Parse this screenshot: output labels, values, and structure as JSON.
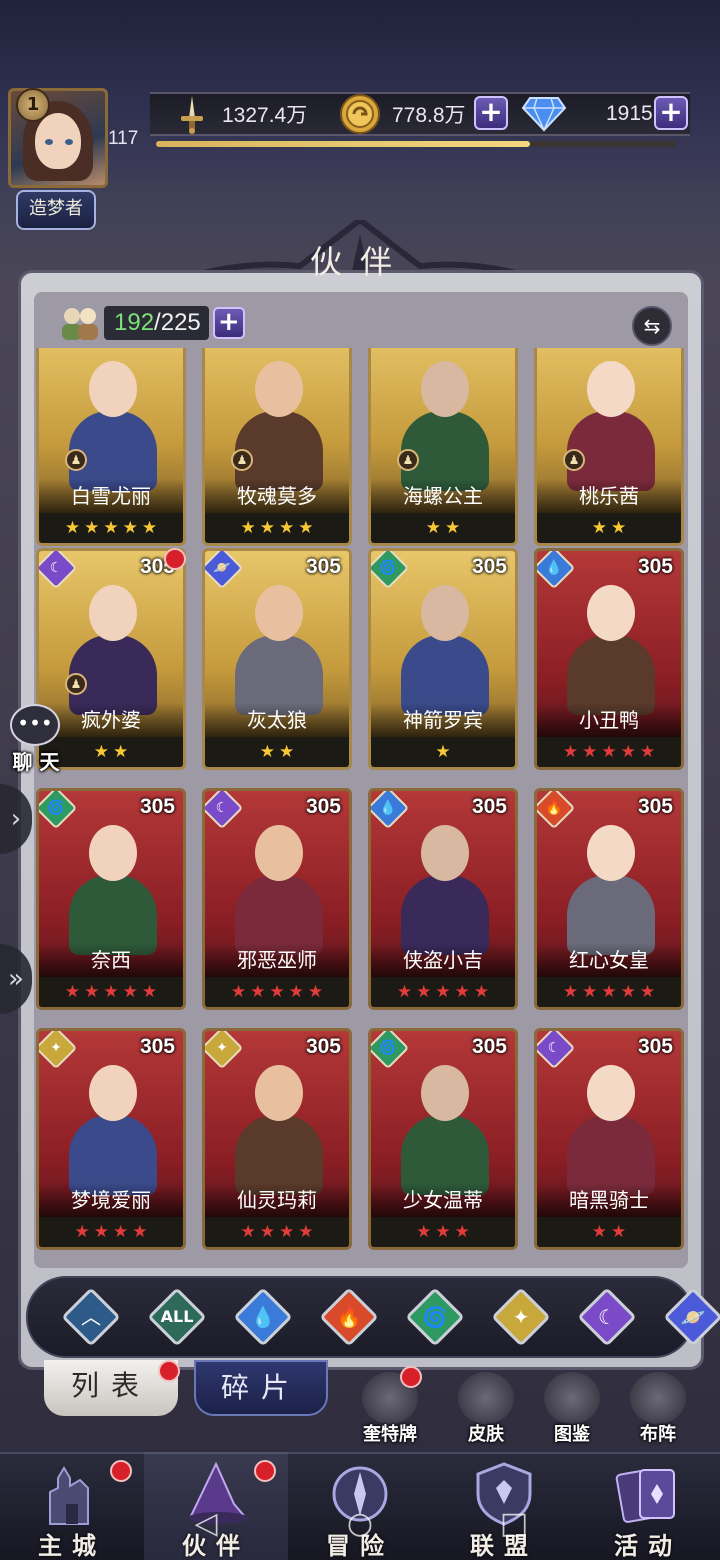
{
  "player": {
    "level": "1",
    "power_level": "117",
    "title": "造梦者",
    "exp_progress": 0.72
  },
  "resources": {
    "power": "1327.4万",
    "gold": "778.8万",
    "gems": "1915"
  },
  "header": {
    "title": "伙伴"
  },
  "roster": {
    "current": "192",
    "separator": "/",
    "max": "225"
  },
  "cards": [
    {
      "name": "白雪尤丽",
      "level": "",
      "stars": 5,
      "theme": "gold",
      "element": ""
    },
    {
      "name": "牧魂莫多",
      "level": "",
      "stars": 4,
      "theme": "gold",
      "element": ""
    },
    {
      "name": "海螺公主",
      "level": "",
      "stars": 2,
      "theme": "gold",
      "element": ""
    },
    {
      "name": "桃乐茜",
      "level": "",
      "stars": 2,
      "theme": "gold",
      "element": ""
    },
    {
      "name": "疯外婆",
      "level": "305",
      "stars": 2,
      "theme": "gold",
      "element": "moon"
    },
    {
      "name": "灰太狼",
      "level": "305",
      "stars": 2,
      "theme": "gold",
      "element": "planet"
    },
    {
      "name": "神箭罗宾",
      "level": "305",
      "stars": 1,
      "theme": "gold",
      "element": "wind"
    },
    {
      "name": "小丑鸭",
      "level": "305",
      "stars": 5,
      "theme": "red",
      "element": "water"
    },
    {
      "name": "奈西",
      "level": "305",
      "stars": 5,
      "theme": "red",
      "element": "wind"
    },
    {
      "name": "邪恶巫师",
      "level": "305",
      "stars": 5,
      "theme": "red",
      "element": "moon"
    },
    {
      "name": "侠盗小吉",
      "level": "305",
      "stars": 5,
      "theme": "red",
      "element": "water"
    },
    {
      "name": "红心女皇",
      "level": "305",
      "stars": 5,
      "theme": "red",
      "element": "fire"
    },
    {
      "name": "梦境爱丽",
      "level": "305",
      "stars": 4,
      "theme": "red",
      "element": "light"
    },
    {
      "name": "仙灵玛莉",
      "level": "305",
      "stars": 4,
      "theme": "red",
      "element": "light"
    },
    {
      "name": "少女温蒂",
      "level": "305",
      "stars": 3,
      "theme": "red",
      "element": "wind"
    },
    {
      "name": "暗黑骑士",
      "level": "305",
      "stars": 2,
      "theme": "red",
      "element": "moon"
    }
  ],
  "chat": {
    "label": "聊 天"
  },
  "filters": [
    {
      "id": "arrow",
      "glyph": "︿"
    },
    {
      "id": "all",
      "glyph": "ALL"
    },
    {
      "id": "water",
      "glyph": "💧"
    },
    {
      "id": "fire",
      "glyph": "🔥"
    },
    {
      "id": "wind",
      "glyph": "🌀"
    },
    {
      "id": "light",
      "glyph": "✦"
    },
    {
      "id": "moon",
      "glyph": "☾"
    },
    {
      "id": "planet",
      "glyph": "🪐"
    }
  ],
  "tabs": {
    "list": "列表",
    "fragments": "碎片"
  },
  "functions": {
    "tarot": "奎特牌",
    "skin": "皮肤",
    "codex": "图鉴",
    "formation": "布阵"
  },
  "nav": {
    "main_city": "主城",
    "partners": "伙伴",
    "adventure": "冒险",
    "alliance": "联盟",
    "events": "活动"
  },
  "colors": {
    "gold_card": "#e8c66a",
    "red_card": "#b43838",
    "star_gold": "#f6c836",
    "star_red": "#e23b3b",
    "count_green": "#7de07a",
    "notify_red": "#d8202a"
  }
}
